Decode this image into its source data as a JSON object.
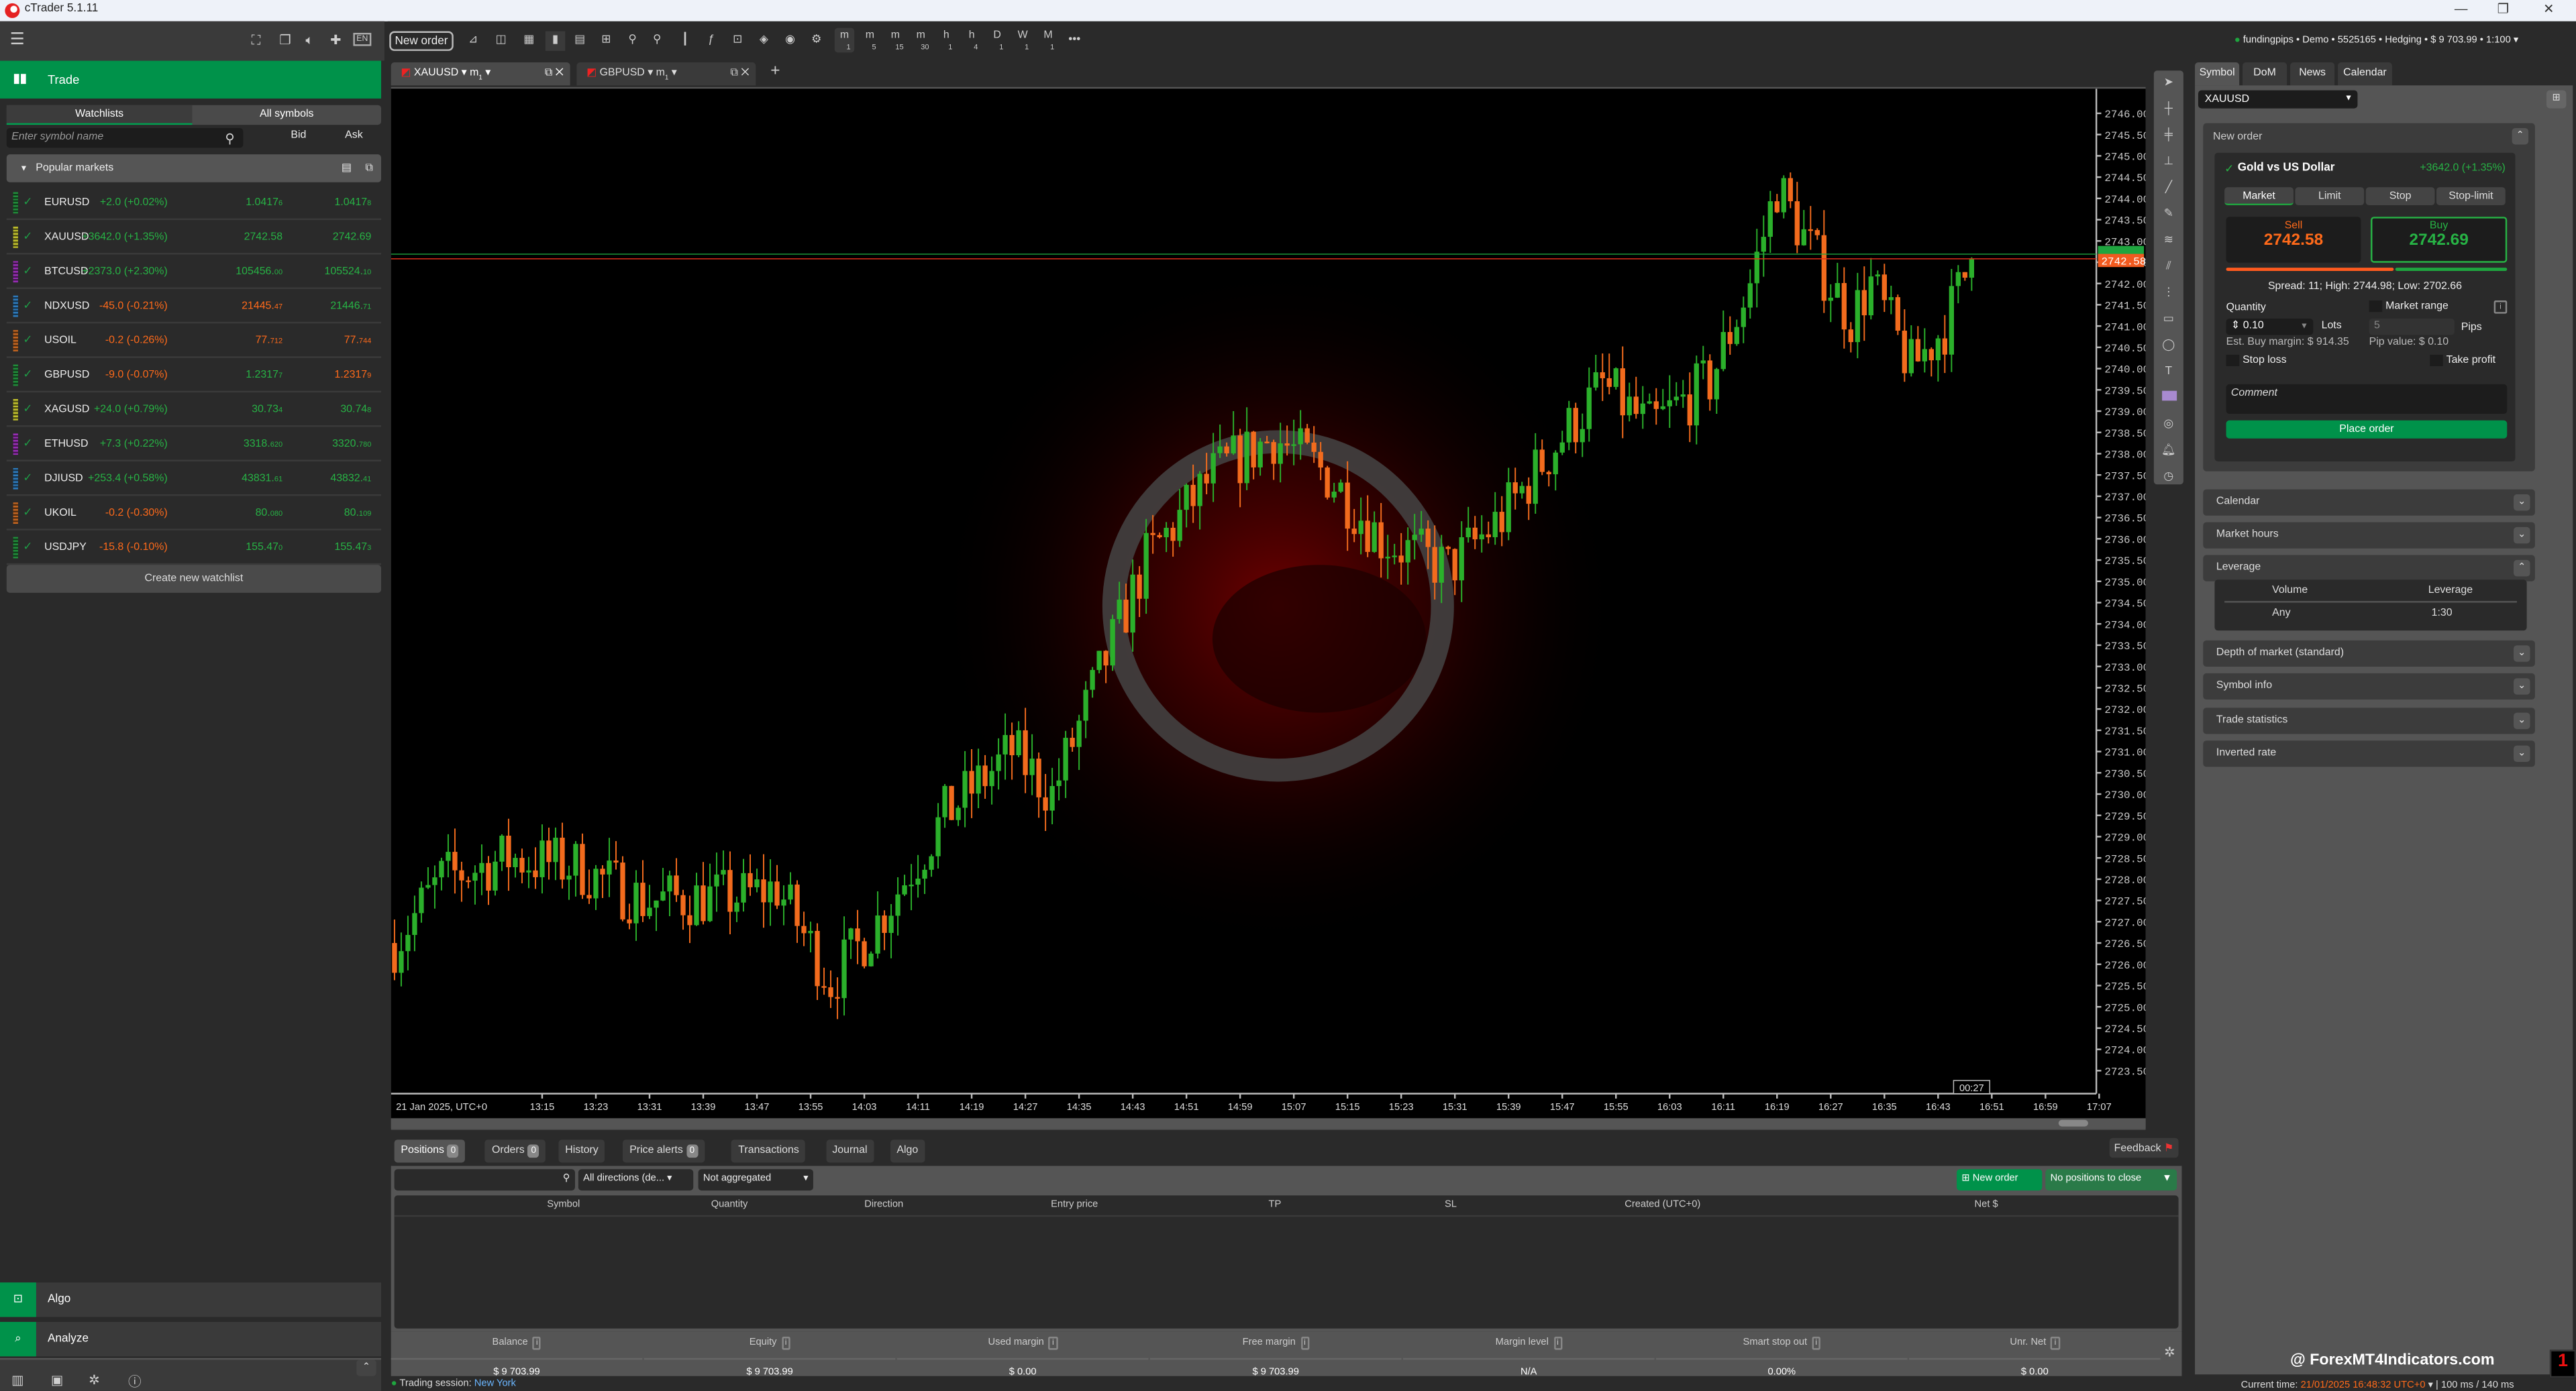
{
  "window": {
    "title": "cTrader 5.1.11",
    "controls": [
      "—",
      "❐",
      "✕"
    ]
  },
  "left": {
    "trade_label": "Trade",
    "tabs": [
      "Watchlists",
      "All symbols"
    ],
    "search_placeholder": "Enter symbol name",
    "bid_header": "Bid",
    "ask_header": "Ask",
    "group": "Popular markets",
    "rows": [
      {
        "symbol": "EURUSD",
        "stripe": "#1fa53f",
        "change": "+2.0 (+0.02%)",
        "cc": "g",
        "bid": "1.0417",
        "bid_s": "6",
        "bc": "g",
        "ask": "1.0417",
        "ask_s": "8",
        "ac": "g"
      },
      {
        "symbol": "XAUUSD",
        "stripe": "#e6e62e",
        "change": "+3642.0 (+1.35%)",
        "cc": "g",
        "bid": "2742.58",
        "bid_s": "",
        "bc": "g",
        "ask": "2742.69",
        "ask_s": "",
        "ac": "g"
      },
      {
        "symbol": "BTCUSD",
        "stripe": "#b42fd8",
        "change": "+2373.0 (+2.30%)",
        "cc": "g",
        "bid": "105456.",
        "bid_s": "00",
        "bc": "g",
        "ask": "105524.",
        "ask_s": "10",
        "ac": "g"
      },
      {
        "symbol": "NDXUSD",
        "stripe": "#2f8fe0",
        "change": "-45.0 (-0.21%)",
        "cc": "r",
        "bid": "21445.",
        "bid_s": "47",
        "bc": "r",
        "ask": "21446.",
        "ask_s": "71",
        "ac": "g"
      },
      {
        "symbol": "USOIL",
        "stripe": "#e8741f",
        "change": "-0.2 (-0.26%)",
        "cc": "r",
        "bid": "77.",
        "bid_s": "712",
        "bc": "r",
        "ask": "77.",
        "ask_s": "744",
        "ac": "r"
      },
      {
        "symbol": "GBPUSD",
        "stripe": "#1fa53f",
        "change": "-9.0 (-0.07%)",
        "cc": "r",
        "bid": "1.2317",
        "bid_s": "7",
        "bc": "g",
        "ask": "1.2317",
        "ask_s": "9",
        "ac": "r"
      },
      {
        "symbol": "XAGUSD",
        "stripe": "#e6e62e",
        "change": "+24.0 (+0.79%)",
        "cc": "g",
        "bid": "30.73",
        "bid_s": "4",
        "bc": "g",
        "ask": "30.74",
        "ask_s": "8",
        "ac": "g"
      },
      {
        "symbol": "ETHUSD",
        "stripe": "#b42fd8",
        "change": "+7.3 (+0.22%)",
        "cc": "g",
        "bid": "3318.",
        "bid_s": "620",
        "bc": "g",
        "ask": "3320.",
        "ask_s": "780",
        "ac": "g"
      },
      {
        "symbol": "DJIUSD",
        "stripe": "#2f8fe0",
        "change": "+253.4 (+0.58%)",
        "cc": "g",
        "bid": "43831.",
        "bid_s": "61",
        "bc": "g",
        "ask": "43832.",
        "ask_s": "41",
        "ac": "g"
      },
      {
        "symbol": "UKOIL",
        "stripe": "#e8741f",
        "change": "-0.2 (-0.30%)",
        "cc": "r",
        "bid": "80.",
        "bid_s": "080",
        "bc": "g",
        "ask": "80.",
        "ask_s": "109",
        "ac": "g"
      },
      {
        "symbol": "USDJPY",
        "stripe": "#1fa53f",
        "change": "-15.8 (-0.10%)",
        "cc": "r",
        "bid": "155.47",
        "bid_s": "0",
        "bc": "g",
        "ask": "155.47",
        "ask_s": "3",
        "ac": "g"
      }
    ],
    "create_watchlist": "Create new watchlist",
    "algo_label": "Algo",
    "analyze_label": "Analyze"
  },
  "toolbar": {
    "new_order": "New order",
    "timeframes": [
      [
        "m",
        "1"
      ],
      [
        "m",
        "5"
      ],
      [
        "m",
        "15"
      ],
      [
        "m",
        "30"
      ],
      [
        "h",
        "1"
      ],
      [
        "h",
        "4"
      ],
      [
        "D",
        "1"
      ],
      [
        "W",
        "1"
      ],
      [
        "M",
        "1"
      ]
    ],
    "more": "•••"
  },
  "chart_tabs": [
    {
      "symbol": "XAUUSD",
      "tf": "m",
      "tf_n": "1"
    },
    {
      "symbol": "GBPUSD",
      "tf": "m",
      "tf_n": "1"
    }
  ],
  "account": "fundingpips • Demo • 5525165 • Hedging • $ 9 703.99 • 1:100",
  "chart_data": {
    "type": "candlestick",
    "symbol": "XAUUSD",
    "timeframe": "m1",
    "date_label": "21 Jan 2025, UTC+0",
    "x_ticks": [
      "13:15",
      "13:23",
      "13:31",
      "13:39",
      "13:47",
      "13:55",
      "14:03",
      "14:11",
      "14:19",
      "14:27",
      "14:35",
      "14:43",
      "14:51",
      "14:59",
      "15:07",
      "15:15",
      "15:23",
      "15:31",
      "15:39",
      "15:47",
      "15:55",
      "16:03",
      "16:11",
      "16:19",
      "16:27",
      "16:35",
      "16:43",
      "16:51",
      "16:59",
      "17:07"
    ],
    "ylim": [
      2723.5,
      2746.0
    ],
    "y_tick_step": 0.5,
    "bid": "2742.58",
    "ask": "2742.69",
    "countdown": "00:27",
    "price_path": [
      [
        "12:53",
        2726.5
      ],
      [
        "13:00",
        2728.0
      ],
      [
        "13:10",
        2728.5
      ],
      [
        "13:20",
        2728.3
      ],
      [
        "13:30",
        2727.5
      ],
      [
        "13:45",
        2727.6
      ],
      [
        "13:50",
        2727.8
      ],
      [
        "13:58",
        2725.6
      ],
      [
        "14:05",
        2727.0
      ],
      [
        "14:15",
        2729.5
      ],
      [
        "14:25",
        2731.0
      ],
      [
        "14:31",
        2730.0
      ],
      [
        "14:36",
        2732.0
      ],
      [
        "14:45",
        2735.5
      ],
      [
        "14:55",
        2737.5
      ],
      [
        "15:04",
        2738.4
      ],
      [
        "15:12",
        2737.5
      ],
      [
        "15:20",
        2736.0
      ],
      [
        "15:30",
        2735.3
      ],
      [
        "15:38",
        2736.5
      ],
      [
        "15:45",
        2738.0
      ],
      [
        "15:53",
        2739.6
      ],
      [
        "16:00",
        2738.6
      ],
      [
        "16:09",
        2739.7
      ],
      [
        "16:15",
        2742.0
      ],
      [
        "16:19",
        2744.3
      ],
      [
        "16:25",
        2742.5
      ],
      [
        "16:30",
        2741.2
      ],
      [
        "16:33",
        2742.0
      ],
      [
        "16:39",
        2740.0
      ],
      [
        "16:44",
        2741.0
      ],
      [
        "16:48",
        2742.58
      ]
    ]
  },
  "bottom": {
    "tabs": [
      {
        "label": "Positions",
        "badge": "0"
      },
      {
        "label": "Orders",
        "badge": "0"
      },
      {
        "label": "History"
      },
      {
        "label": "Price alerts",
        "badge": "0"
      },
      {
        "label": "Transactions"
      },
      {
        "label": "Journal"
      },
      {
        "label": "Algo"
      }
    ],
    "feedback": "Feedback",
    "direction_filter": "All directions (de...",
    "aggregation": "Not aggregated",
    "new_order": "New order",
    "close_positions": "No positions to close",
    "columns": [
      "Symbol",
      "Quantity",
      "Direction",
      "Entry price",
      "TP",
      "SL",
      "Created (UTC+0)",
      "Net $"
    ],
    "stats": [
      {
        "label": "Balance",
        "value": "$ 9 703.99"
      },
      {
        "label": "Equity",
        "value": "$ 9 703.99"
      },
      {
        "label": "Used margin",
        "value": "$ 0.00"
      },
      {
        "label": "Free margin",
        "value": "$ 9 703.99"
      },
      {
        "label": "Margin level",
        "value": "N/A"
      },
      {
        "label": "Smart stop out",
        "value": "0.00%"
      },
      {
        "label": "Unr. Net",
        "value": "$ 0.00"
      }
    ]
  },
  "right": {
    "tabs": [
      "Symbol",
      "DoM",
      "News",
      "Calendar"
    ],
    "symbol": "XAUUSD",
    "new_order": "New order",
    "symbol_name": "Gold vs US Dollar",
    "change": "+3642.0 (+1.35%)",
    "order_types": [
      "Market",
      "Limit",
      "Stop",
      "Stop-limit"
    ],
    "sell_label": "Sell",
    "sell_price": "2742.58",
    "buy_label": "Buy",
    "buy_price": "2742.69",
    "spread_info": "Spread: 11; High: 2744.98; Low: 2702.66",
    "quantity_label": "Quantity",
    "quantity": "0.10",
    "lots": "Lots",
    "market_range": "Market range",
    "pips_value": "5",
    "pips": "Pips",
    "est_margin": "Est. Buy margin: $ 914.35",
    "pip_value": "Pip value: $ 0.10",
    "stop_loss": "Stop loss",
    "take_profit": "Take profit",
    "comment_placeholder": "Comment",
    "place_order": "Place order",
    "sections": [
      "Calendar",
      "Market hours",
      "Leverage",
      "Depth of market (standard)",
      "Symbol info",
      "Trade statistics",
      "Inverted rate"
    ],
    "leverage_table": {
      "headers": [
        "Volume",
        "Leverage"
      ],
      "row": [
        "Any",
        "1:30"
      ]
    }
  },
  "status": {
    "session_label": "Trading session:",
    "session": "New York",
    "time_label": "Current time:",
    "time": "21/01/2025 16:48:32",
    "tz": "UTC+0",
    "latency": "100 ms / 140 ms"
  },
  "watermark": "@ ForexMT4Indicators.com",
  "colors": {
    "green": "#00924a",
    "buy": "#27b345",
    "sell": "#ff6a1a",
    "bg": "#2a2a2a"
  }
}
